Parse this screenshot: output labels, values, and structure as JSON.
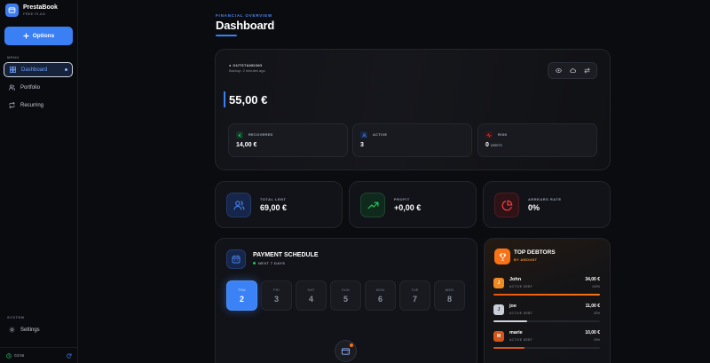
{
  "brand": {
    "name": "PrestaBook",
    "plan": "FREE PLAN"
  },
  "sidebar": {
    "options_label": "Options",
    "menu_label": "MENU",
    "items": [
      {
        "label": "Dashboard",
        "icon": "grid-icon",
        "active": true
      },
      {
        "label": "Portfolio",
        "icon": "users-icon"
      },
      {
        "label": "Recurring",
        "icon": "repeat-icon"
      }
    ],
    "system_label": "SYSTEM",
    "settings_label": "Settings",
    "footer_time": "03:56"
  },
  "header": {
    "eyebrow": "FINANCIAL OVERVIEW",
    "title": "Dashboard"
  },
  "outstanding": {
    "label": "OUTSTANDING",
    "backup": "Backup: 2 minutes ago",
    "amount": "55,00 €",
    "recovered": {
      "label": "RECOVERED",
      "value": "14,00 €"
    },
    "active": {
      "label": "ACTIVE",
      "value": "3"
    },
    "risk": {
      "label": "RISK",
      "value": "0",
      "unit": "DEBTS"
    }
  },
  "stats": {
    "total_lent": {
      "label": "TOTAL LENT",
      "value": "69,00 €"
    },
    "profit": {
      "label": "PROFIT",
      "value": "+0,00 €"
    },
    "arrears": {
      "label": "ARREARS RATE",
      "value": "0%"
    }
  },
  "schedule": {
    "title": "PAYMENT SCHEDULE",
    "subtitle": "NEXT 7 DAYS",
    "days": [
      {
        "name": "THU",
        "num": "2",
        "active": true
      },
      {
        "name": "FRI",
        "num": "3"
      },
      {
        "name": "SAT",
        "num": "4"
      },
      {
        "name": "SUN",
        "num": "5"
      },
      {
        "name": "MON",
        "num": "6"
      },
      {
        "name": "TUE",
        "num": "7"
      },
      {
        "name": "WED",
        "num": "8"
      }
    ]
  },
  "top_debtors": {
    "title": "TOP DEBTORS",
    "subtitle": "BY AMOUNT",
    "items": [
      {
        "initial": "J",
        "name": "John",
        "status": "ACTIVE DEBT",
        "amount": "34,00 €",
        "pct": "100%",
        "fill": 1.0,
        "color": "#f08a24"
      },
      {
        "initial": "J",
        "name": "joe",
        "status": "ACTIVE DEBT",
        "amount": "11,00 €",
        "pct": "32%",
        "fill": 0.32,
        "color": "#c9ced8"
      },
      {
        "initial": "M",
        "name": "marie",
        "status": "ACTIVE DEBT",
        "amount": "10,00 €",
        "pct": "29%",
        "fill": 0.29,
        "color": "#d2561a"
      }
    ]
  },
  "colors": {
    "accent": "#3b7ff5",
    "green": "#22c55e",
    "red": "#ef4444",
    "orange": "#f97316"
  }
}
